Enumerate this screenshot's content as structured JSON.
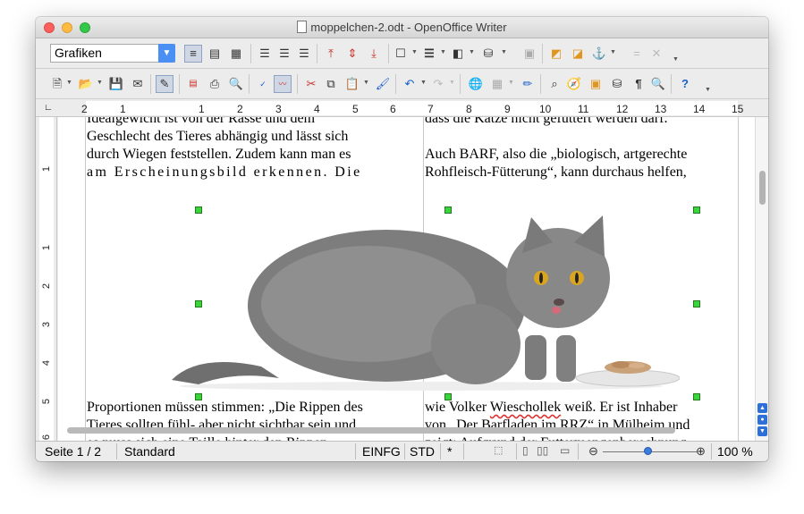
{
  "window": {
    "title": "moppelchen-2.odt - OpenOffice Writer"
  },
  "toolbar1": {
    "style_value": "Grafiken",
    "icons": [
      "wrap-off-icon",
      "wrap-page-icon",
      "wrap-optimal-icon",
      "align-left-icon",
      "align-center-icon",
      "align-right-icon",
      "align-top-icon",
      "align-middle-icon",
      "align-bottom-icon",
      "borders-icon",
      "line-style-icon",
      "border-color-icon",
      "background-color-icon",
      "frame-properties-icon",
      "bring-to-front-icon",
      "send-to-back-icon",
      "anchor-icon",
      "separator-icon",
      "close-toolbar-icon"
    ]
  },
  "toolbar2": {
    "icons": [
      "new-icon",
      "open-icon",
      "save-icon",
      "email-icon",
      "edit-file-icon",
      "pdf-icon",
      "print-icon",
      "page-preview-icon",
      "spellcheck-icon",
      "autospellcheck-icon",
      "cut-icon",
      "copy-icon",
      "paste-icon",
      "clone-formatting-icon",
      "undo-icon",
      "redo-icon",
      "hyperlink-icon",
      "table-icon",
      "draw-functions-icon",
      "find-replace-icon",
      "navigator-icon",
      "gallery-icon",
      "data-sources-icon",
      "formatting-marks-icon",
      "zoom-icon",
      "help-icon"
    ]
  },
  "ruler": {
    "labels": [
      "2",
      "1",
      "1",
      "2",
      "3",
      "4",
      "5",
      "6",
      "7",
      "8",
      "9",
      "10",
      "11",
      "12",
      "13",
      "14",
      "15"
    ],
    "vlabels": [
      "1",
      "1",
      "2",
      "3",
      "4",
      "5",
      "6"
    ]
  },
  "document": {
    "top_left": [
      "Idealgewicht ist von der Rasse und dem",
      "Geschlecht des Tieres abhängig und lässt sich",
      "durch Wiegen feststellen. Zudem kann man es",
      "am Erscheinungsbild erkennen. Die"
    ],
    "top_right": [
      "dass die Katze nicht gefüttert werden darf.",
      "Auch BARF, also die „biologisch, artgerechte",
      "Rohfleisch-Fütterung“, kann durchaus helfen,"
    ],
    "bottom_left": [
      "Proportionen müssen stimmen: „Die Rippen des",
      "Tieres sollten fühl- aber nicht sichtbar sein und",
      "es muss sich eine Taille hinter den Rippen"
    ],
    "bottom_right": {
      "line1_before": "wie Volker ",
      "line1_name": "Wieschollek",
      "line1_after": " weiß. Er ist Inhaber",
      "line2": "von „Der Barfladen im RRZ“ in Mülheim und",
      "line3": "zeigt: Aufgrund der Futtermengenberechnung"
    }
  },
  "statusbar": {
    "page": "Seite 1 / 2",
    "style": "Standard",
    "insert_mode": "EINFG",
    "selection_mode": "STD",
    "modified": "*",
    "zoom": "100 %"
  },
  "colors": {
    "selection_handle": "#3bd43b",
    "style_arrow": "#4a8ff4",
    "nav_button": "#2f6fd8"
  }
}
